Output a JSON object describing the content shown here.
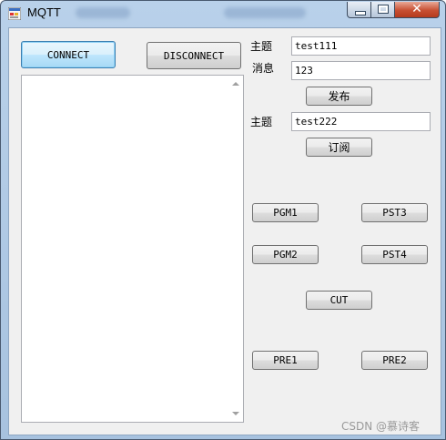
{
  "window": {
    "title": "MQTT"
  },
  "left": {
    "connect_label": "CONNECT",
    "disconnect_label": "DISCONNECT"
  },
  "publish": {
    "topic_label": "主题",
    "topic_value": "test111",
    "message_label": "消息",
    "message_value": "123",
    "publish_label": "发布"
  },
  "subscribe": {
    "topic_label": "主题",
    "topic_value": "test222",
    "subscribe_label": "订阅"
  },
  "buttons": {
    "pgm1": "PGM1",
    "pst3": "PST3",
    "pgm2": "PGM2",
    "pst4": "PST4",
    "cut": "CUT",
    "pre1": "PRE1",
    "pre2": "PRE2"
  },
  "watermark": "CSDN @慕诗客"
}
